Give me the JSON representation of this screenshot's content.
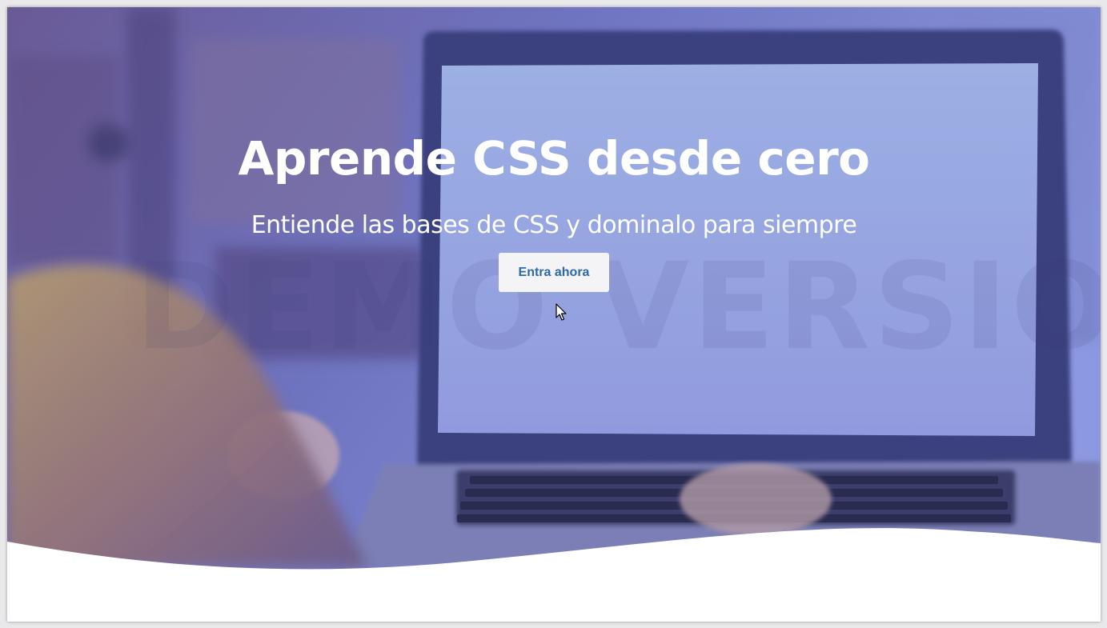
{
  "hero": {
    "title": "Aprende CSS desde cero",
    "subtitle": "Entiende las bases de CSS y dominalo para siempre",
    "cta_label": "Entra ahora",
    "watermark": "DEMO VERSION"
  },
  "colors": {
    "overlay_left": "#5b4d8f",
    "overlay_right": "#8f99e0",
    "button_bg": "#f4f4f6",
    "button_text": "#2f6aa8",
    "text": "#ffffff"
  },
  "icons": {
    "cursor": "mouse-pointer-icon"
  }
}
